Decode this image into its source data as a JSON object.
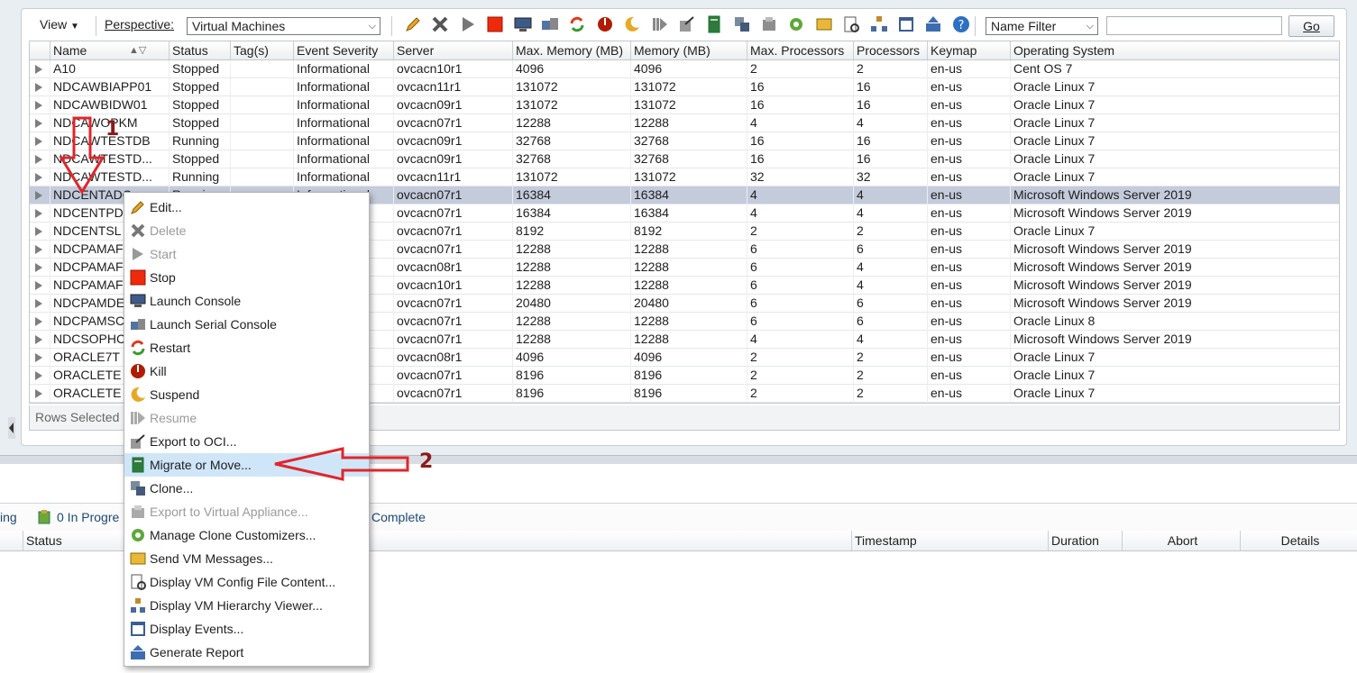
{
  "toolbar": {
    "view_label": "View",
    "perspective_label": "Perspective:",
    "perspective_value": "Virtual Machines",
    "filter_type": "Name Filter",
    "filter_value": "",
    "go_label": "Go",
    "icons": [
      "edit-icon",
      "delete-icon",
      "start-icon",
      "stop-icon",
      "launch-console-icon",
      "launch-serial-console-icon",
      "restart-icon",
      "kill-icon",
      "suspend-icon",
      "resume-icon",
      "export-oci-icon",
      "migrate-icon",
      "clone-icon",
      "export-appliance-icon",
      "clone-customizer-icon",
      "send-message-icon",
      "config-file-icon",
      "hierarchy-icon",
      "events-icon",
      "report-icon",
      "help-icon"
    ]
  },
  "table": {
    "columns": [
      "Name",
      "Status",
      "Tag(s)",
      "Event Severity",
      "Server",
      "Max. Memory (MB)",
      "Memory (MB)",
      "Max. Processors",
      "Processors",
      "Keymap",
      "Operating System"
    ],
    "rows": [
      [
        "A10",
        "Stopped",
        "",
        "Informational",
        "ovcacn10r1",
        "4096",
        "4096",
        "2",
        "2",
        "en-us",
        "Cent OS 7"
      ],
      [
        "NDCAWBIAPP01",
        "Stopped",
        "",
        "Informational",
        "ovcacn11r1",
        "131072",
        "131072",
        "16",
        "16",
        "en-us",
        "Oracle Linux 7"
      ],
      [
        "NDCAWBIDW01",
        "Stopped",
        "",
        "Informational",
        "ovcacn09r1",
        "131072",
        "131072",
        "16",
        "16",
        "en-us",
        "Oracle Linux 7"
      ],
      [
        "NDCAWOPKM",
        "Stopped",
        "",
        "Informational",
        "ovcacn07r1",
        "12288",
        "12288",
        "4",
        "4",
        "en-us",
        "Oracle Linux 7"
      ],
      [
        "NDCAWTESTDB",
        "Running",
        "",
        "Informational",
        "ovcacn09r1",
        "32768",
        "32768",
        "16",
        "16",
        "en-us",
        "Oracle Linux 7"
      ],
      [
        "NDCAWTESTD...",
        "Stopped",
        "",
        "Informational",
        "ovcacn09r1",
        "32768",
        "32768",
        "16",
        "16",
        "en-us",
        "Oracle Linux 7"
      ],
      [
        "NDCAWTESTD...",
        "Running",
        "",
        "Informational",
        "ovcacn11r1",
        "131072",
        "131072",
        "32",
        "32",
        "en-us",
        "Oracle Linux 7"
      ],
      [
        "NDCENTADC",
        "Running",
        "",
        "Informational",
        "ovcacn07r1",
        "16384",
        "16384",
        "4",
        "4",
        "en-us",
        "Microsoft Windows Server 2019"
      ],
      [
        "NDCENTPD",
        "",
        "",
        "",
        "ovcacn07r1",
        "16384",
        "16384",
        "4",
        "4",
        "en-us",
        "Microsoft Windows Server 2019"
      ],
      [
        "NDCENTSL",
        "",
        "",
        "",
        "ovcacn07r1",
        "8192",
        "8192",
        "2",
        "2",
        "en-us",
        "Oracle Linux 7"
      ],
      [
        "NDCPAMAF",
        "",
        "",
        "",
        "ovcacn07r1",
        "12288",
        "12288",
        "6",
        "6",
        "en-us",
        "Microsoft Windows Server 2019"
      ],
      [
        "NDCPAMAF",
        "",
        "",
        "",
        "ovcacn08r1",
        "12288",
        "12288",
        "6",
        "4",
        "en-us",
        "Microsoft Windows Server 2019"
      ],
      [
        "NDCPAMAF",
        "",
        "",
        "",
        "ovcacn10r1",
        "12288",
        "12288",
        "6",
        "4",
        "en-us",
        "Microsoft Windows Server 2019"
      ],
      [
        "NDCPAMDE",
        "",
        "",
        "",
        "ovcacn07r1",
        "20480",
        "20480",
        "6",
        "6",
        "en-us",
        "Microsoft Windows Server 2019"
      ],
      [
        "NDCPAMSC",
        "",
        "",
        "",
        "ovcacn07r1",
        "12288",
        "12288",
        "6",
        "6",
        "en-us",
        "Oracle Linux 8"
      ],
      [
        "NDCSOPHC",
        "",
        "",
        "",
        "ovcacn07r1",
        "12288",
        "12288",
        "4",
        "4",
        "en-us",
        "Microsoft Windows Server 2019"
      ],
      [
        "ORACLE7T",
        "",
        "",
        "",
        "ovcacn08r1",
        "4096",
        "4096",
        "2",
        "2",
        "en-us",
        "Oracle Linux 7"
      ],
      [
        "ORACLETE",
        "",
        "",
        "",
        "ovcacn07r1",
        "8196",
        "8196",
        "2",
        "2",
        "en-us",
        "Oracle Linux 7"
      ],
      [
        "ORACLETE",
        "",
        "",
        "",
        "ovcacn07r1",
        "8196",
        "8196",
        "2",
        "2",
        "en-us",
        "Oracle Linux 7"
      ]
    ],
    "selected_row": 7,
    "footer": "Rows Selected"
  },
  "context_menu": [
    {
      "label": "Edit...",
      "icon": "edit-icon",
      "disabled": false
    },
    {
      "label": "Delete",
      "icon": "delete-icon",
      "disabled": true
    },
    {
      "label": "Start",
      "icon": "start-icon",
      "disabled": true
    },
    {
      "label": "Stop",
      "icon": "stop-icon",
      "disabled": false
    },
    {
      "label": "Launch Console",
      "icon": "launch-console-icon",
      "disabled": false
    },
    {
      "label": "Launch Serial Console",
      "icon": "launch-serial-console-icon",
      "disabled": false
    },
    {
      "label": "Restart",
      "icon": "restart-icon",
      "disabled": false
    },
    {
      "label": "Kill",
      "icon": "kill-icon",
      "disabled": false
    },
    {
      "label": "Suspend",
      "icon": "suspend-icon",
      "disabled": false
    },
    {
      "label": "Resume",
      "icon": "resume-icon",
      "disabled": true
    },
    {
      "label": "Export to OCI...",
      "icon": "export-oci-icon",
      "disabled": false
    },
    {
      "label": "Migrate or Move...",
      "icon": "migrate-icon",
      "disabled": false,
      "highlighted": true
    },
    {
      "label": "Clone...",
      "icon": "clone-icon",
      "disabled": false
    },
    {
      "label": "Export to Virtual Appliance...",
      "icon": "export-appliance-icon",
      "disabled": true
    },
    {
      "label": "Manage Clone Customizers...",
      "icon": "clone-customizer-icon",
      "disabled": false
    },
    {
      "label": "Send VM Messages...",
      "icon": "send-message-icon",
      "disabled": false
    },
    {
      "label": "Display VM Config File Content...",
      "icon": "config-file-icon",
      "disabled": false
    },
    {
      "label": "Display VM Hierarchy Viewer...",
      "icon": "hierarchy-icon",
      "disabled": false
    },
    {
      "label": "Display Events...",
      "icon": "events-icon",
      "disabled": false
    },
    {
      "label": "Generate Report",
      "icon": "report-icon",
      "disabled": false
    }
  ],
  "jobs": {
    "left_text": "ing",
    "in_progress": "0 In Progre",
    "complete": "Complete",
    "columns": [
      "Status",
      "Timestamp",
      "Duration",
      "Abort",
      "Details"
    ]
  },
  "annotations": {
    "marker1": "1",
    "marker2": "2",
    "arrow_color": "#e0262b"
  }
}
